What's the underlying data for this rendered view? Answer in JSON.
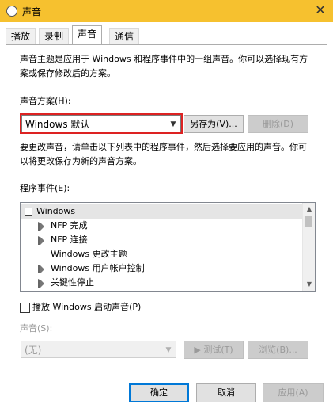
{
  "window": {
    "title": "声音",
    "close_glyph": "✕"
  },
  "tabs": [
    {
      "label": "播放"
    },
    {
      "label": "录制"
    },
    {
      "label": "声音"
    },
    {
      "label": "通信"
    }
  ],
  "description": {
    "line1": "声音主题是应用于 Windows 和程序事件中的一组声音。你可以选择现有方",
    "line2": "案或保存修改后的方案。"
  },
  "scheme": {
    "label": "声音方案(H):",
    "selected": "Windows 默认",
    "save_as_label": "另存为(V)...",
    "delete_label": "删除(D)",
    "highlight_color": "#d22222"
  },
  "instructions": {
    "line1": "要更改声音，请单击以下列表中的程序事件，然后选择要应用的声音。你可",
    "line2": "以将更改保存为新的声音方案。"
  },
  "events": {
    "label": "程序事件(E):",
    "items": [
      {
        "label": "Windows",
        "icon": "windows-icon",
        "level": 0
      },
      {
        "label": "NFP 完成",
        "icon": "speaker-icon",
        "level": 1
      },
      {
        "label": "NFP 连接",
        "icon": "speaker-icon",
        "level": 1
      },
      {
        "label": "Windows 更改主题",
        "icon": "none",
        "level": 1
      },
      {
        "label": "Windows 用户帐户控制",
        "icon": "speaker-icon",
        "level": 1
      },
      {
        "label": "关键性停止",
        "icon": "speaker-icon",
        "level": 1
      }
    ]
  },
  "startup": {
    "label": "播放 Windows 启动声音(P)",
    "checked": false
  },
  "sounds": {
    "label": "声音(S):",
    "selected": "(无)",
    "test_label": "测试(T)",
    "browse_label": "浏览(B)..."
  },
  "footer": {
    "ok_label": "确定",
    "cancel_label": "取消",
    "apply_label": "应用(A)"
  }
}
